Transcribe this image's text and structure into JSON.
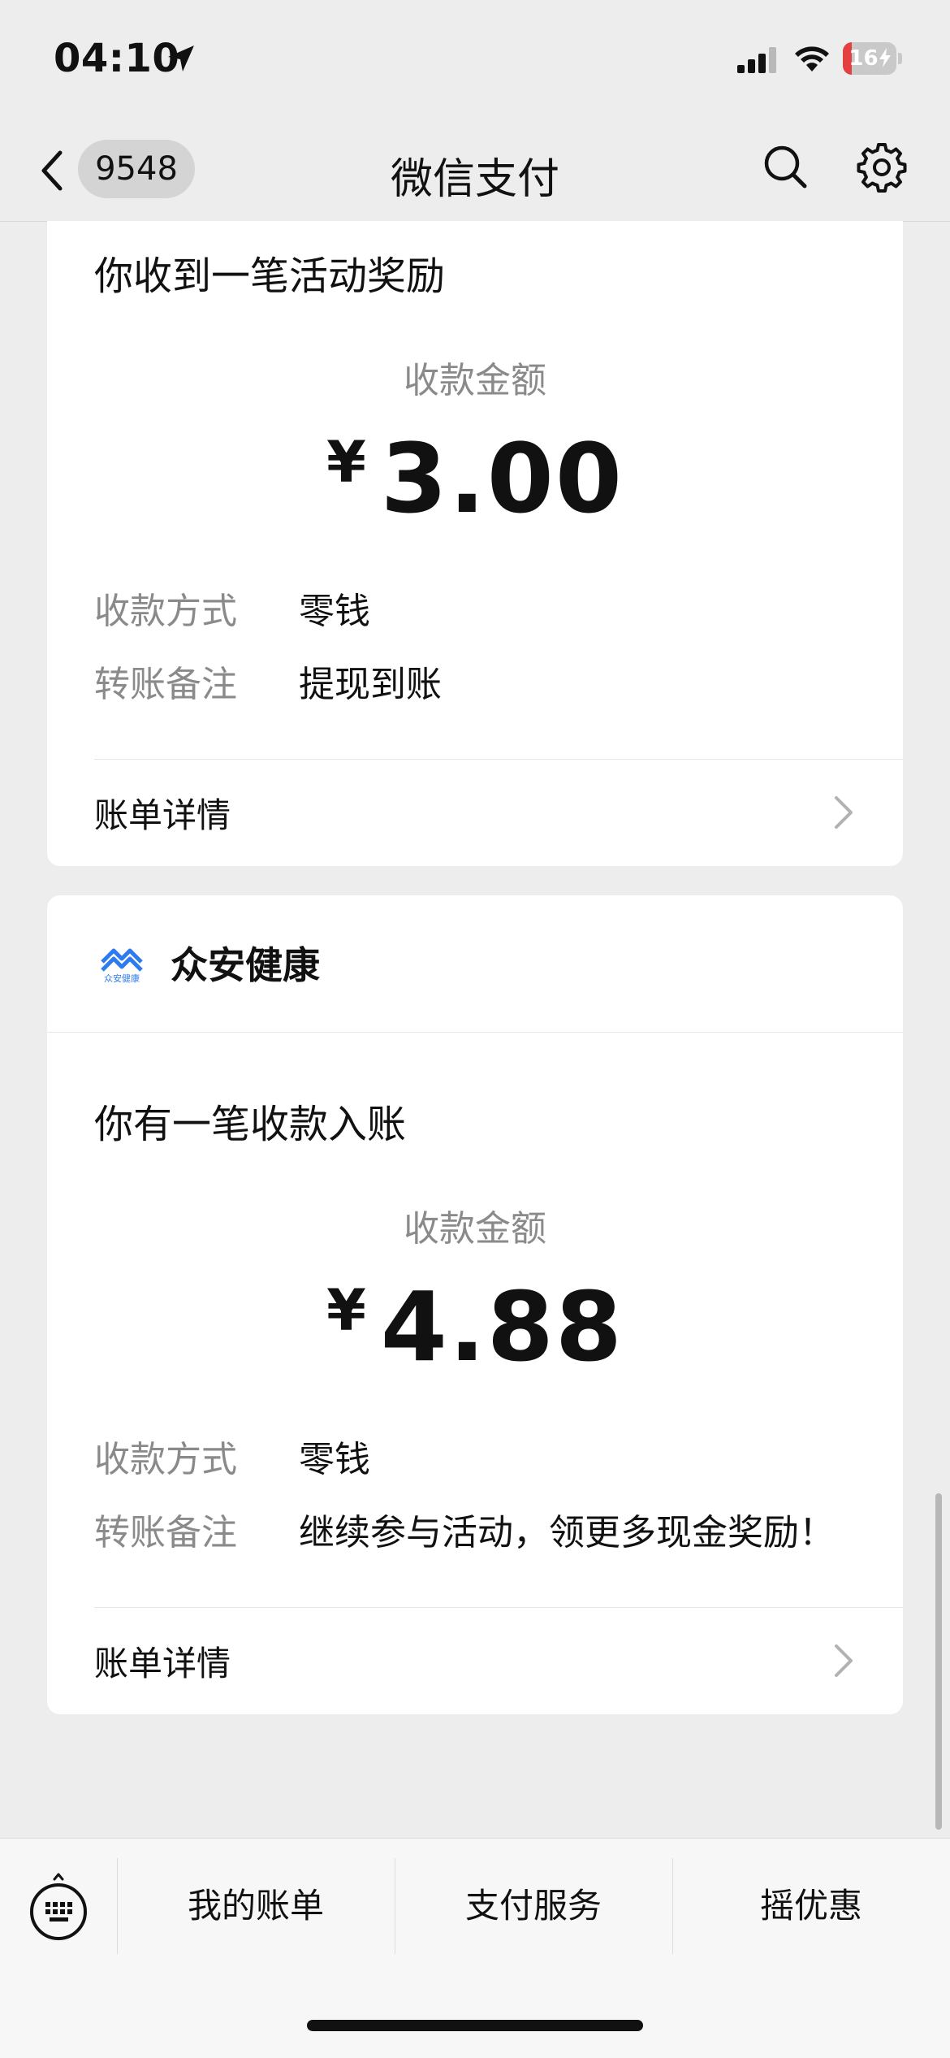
{
  "status_bar": {
    "time": "04:10",
    "battery": "16",
    "battery_level": 0.16
  },
  "nav": {
    "unread_count": "9548",
    "title": "微信支付"
  },
  "card1": {
    "headline": "你收到一笔活动奖励",
    "amount_label": "收款金额",
    "currency": "¥",
    "amount": "3.00",
    "rows": [
      {
        "label": "收款方式",
        "value": "零钱"
      },
      {
        "label": "转账备注",
        "value": "提现到账"
      }
    ],
    "detail_label": "账单详情"
  },
  "card2": {
    "merchant_name": "众安健康",
    "logo_text": "众安健康",
    "headline": "你有一笔收款入账",
    "amount_label": "收款金额",
    "currency": "¥",
    "amount": "4.88",
    "rows": [
      {
        "label": "收款方式",
        "value": "零钱"
      },
      {
        "label": "转账备注",
        "value": "继续参与活动，领更多现金奖励！"
      }
    ],
    "detail_label": "账单详情"
  },
  "bottom_menu": {
    "items": [
      "我的账单",
      "支付服务",
      "摇优惠"
    ]
  },
  "colors": {
    "background": "#ededed",
    "card": "#ffffff",
    "muted_text": "#8a8a8a",
    "battery_low": "#e3403f",
    "logo_blue": "#2d7bf0"
  }
}
